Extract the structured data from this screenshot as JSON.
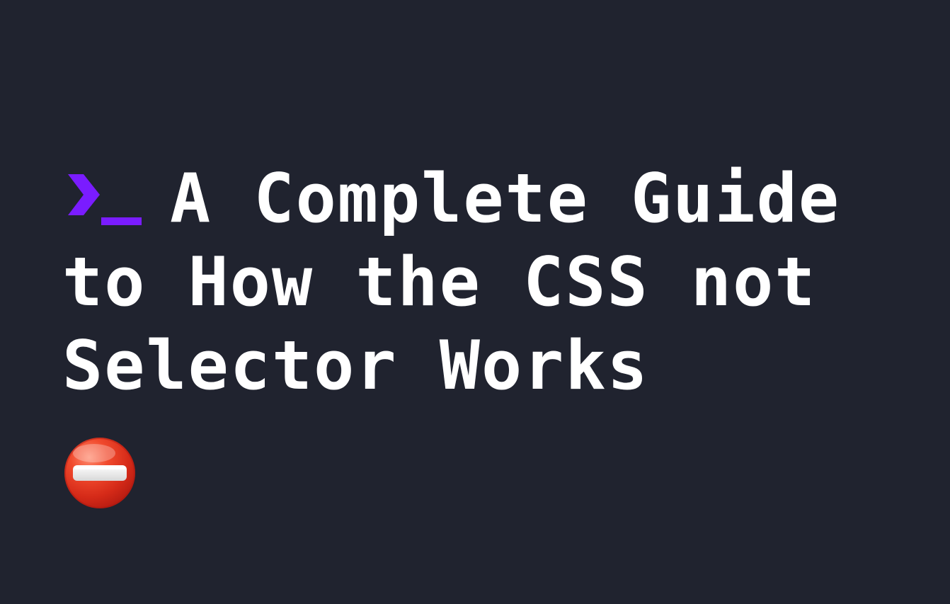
{
  "page": {
    "background_color": "#20232f"
  },
  "title": {
    "lines": [
      "A Complete Guide",
      "to How the CSS not",
      "Selector Works"
    ]
  },
  "icons": {
    "prompt": {
      "name": "terminal-prompt-icon",
      "color": "#7a1cff"
    },
    "emoji": {
      "name": "no-entry-icon",
      "color": "#e5341f"
    }
  }
}
